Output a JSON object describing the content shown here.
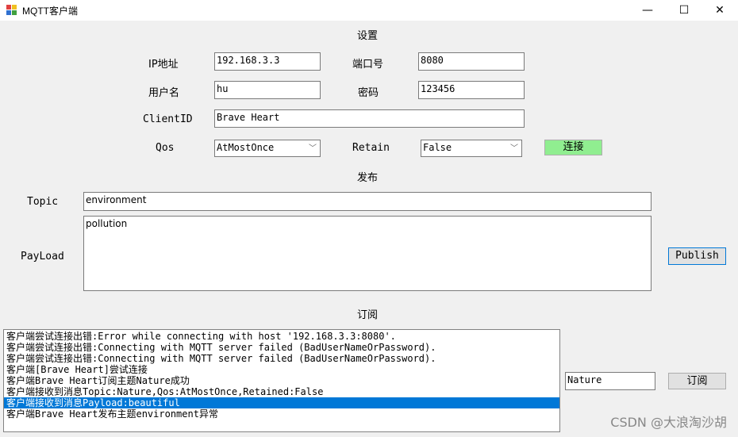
{
  "window": {
    "title": "MQTT客户端",
    "minimize": "—",
    "maximize": "☐",
    "close": "✕"
  },
  "settings": {
    "heading": "设置",
    "ip_label": "IP地址",
    "ip_value": "192.168.3.3",
    "port_label": "端口号",
    "port_value": "8080",
    "user_label": "用户名",
    "user_value": "hu",
    "password_label": "密码",
    "password_value": "123456",
    "clientid_label": "ClientID",
    "clientid_value": "Brave Heart",
    "qos_label": "Qos",
    "qos_value": "AtMostOnce",
    "retain_label": "Retain",
    "retain_value": "False",
    "connect_label": "连接",
    "connect_color": "#90ee90"
  },
  "publish": {
    "heading": "发布",
    "topic_label": "Topic",
    "topic_value": "environment",
    "payload_label": "PayLoad",
    "payload_value": "pollution",
    "publish_label": "Publish"
  },
  "subscribe": {
    "heading": "订阅",
    "topic_value": "Nature",
    "subscribe_label": "订阅",
    "log": [
      "客户端尝试连接出错:Error while connecting with host '192.168.3.3:8080'.",
      "客户端尝试连接出错:Connecting with MQTT server failed (BadUserNameOrPassword).",
      "客户端尝试连接出错:Connecting with MQTT server failed (BadUserNameOrPassword).",
      "客户端[Brave Heart]尝试连接",
      "客户端Brave Heart订阅主题Nature成功",
      "客户端接收到消息Topic:Nature,Qos:AtMostOnce,Retained:False",
      "客户端接收到消息Payload:beautiful",
      "客户端Brave Heart发布主题environment异常"
    ],
    "selected_index": 6
  },
  "watermark": "CSDN @大浪淘沙胡"
}
